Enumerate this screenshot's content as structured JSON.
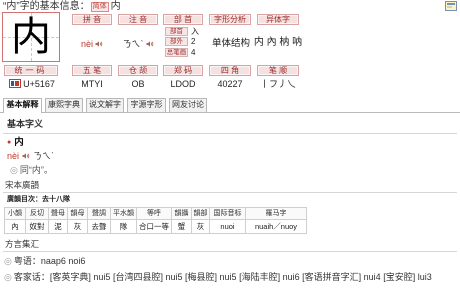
{
  "header": {
    "title": "“内”字的基本信息：",
    "tag": "简体",
    "char": "内",
    "icon": "window-icon"
  },
  "glyph": {
    "char": "内"
  },
  "info": {
    "headers_row1": [
      "拼 音",
      "注 音",
      "部 首",
      "字形分析",
      "异体字"
    ],
    "pinyin": "nèi",
    "zhuyin": "ㄋㄟˋ",
    "radical": {
      "radical_label": "部首",
      "radical_value": "入",
      "outside_label": "部外",
      "outside_value": "2",
      "total_label": "总笔画",
      "total_value": "4"
    },
    "structure": "单体结构",
    "variants": "内 內 枘 呐",
    "headers_row2": [
      "统一码",
      "五 笔",
      "仓 颉",
      "郑 码",
      "四 角",
      "笔 顺"
    ],
    "unicode_icon": "unicode-icon",
    "unicode": "U+5167",
    "wubi": "MTYI",
    "cangjie": "OB",
    "zhengma": "LDOD",
    "sijiao": "40227",
    "bishun": "丨フ丿乀"
  },
  "tabs": [
    {
      "label": "基本解释",
      "active": true
    },
    {
      "label": "康熙字典",
      "active": false
    },
    {
      "label": "说文解字",
      "active": false
    },
    {
      "label": "字源字形",
      "active": false
    },
    {
      "label": "网友讨论",
      "active": false
    }
  ],
  "basic": {
    "title": "基本字义",
    "bullet": "●",
    "head_char": "内",
    "pinyin": "nèi",
    "zhuyin": "ㄋㄟˋ",
    "mark": "◎",
    "definitions": [
      "同“内”。"
    ]
  },
  "guangyun": {
    "title": "宋本廣韻",
    "subtitle": "廣韻目次：去十八隊",
    "columns": [
      "小韻",
      "反切",
      "聲母",
      "韻母",
      "聲調",
      "平水韻",
      "等呼",
      "韻攝",
      "韻部",
      "国际音标",
      "羅马字"
    ],
    "row": [
      "內",
      "奴對",
      "泥",
      "灰",
      "去聲",
      "隊",
      "合口一等",
      "蟹",
      "灰",
      "nuoi",
      "nuaih／nuoy"
    ]
  },
  "dialects": {
    "title": "方言集汇",
    "mark": "◎",
    "cantonese": {
      "label": "粤语：",
      "text": "naap6 noi6"
    },
    "hakka": {
      "label": "客家话：",
      "items": [
        {
          "source": "[客英字典]",
          "value": "nui5"
        },
        {
          "source": "[台湾四县腔]",
          "value": "nui5"
        },
        {
          "source": "[梅县腔]",
          "value": "nui5"
        },
        {
          "source": "[海陆丰腔]",
          "value": "nui6"
        },
        {
          "source": "[客语拼音字汇]",
          "value": "nui4"
        },
        {
          "source": "[宝安腔]",
          "value": "lui3"
        }
      ]
    }
  },
  "colors": {
    "accent_red": "#c0392b",
    "header_bg": "#f6e1e1",
    "header_text": "#9b2c2c",
    "border_gray": "#b9b9b9"
  }
}
